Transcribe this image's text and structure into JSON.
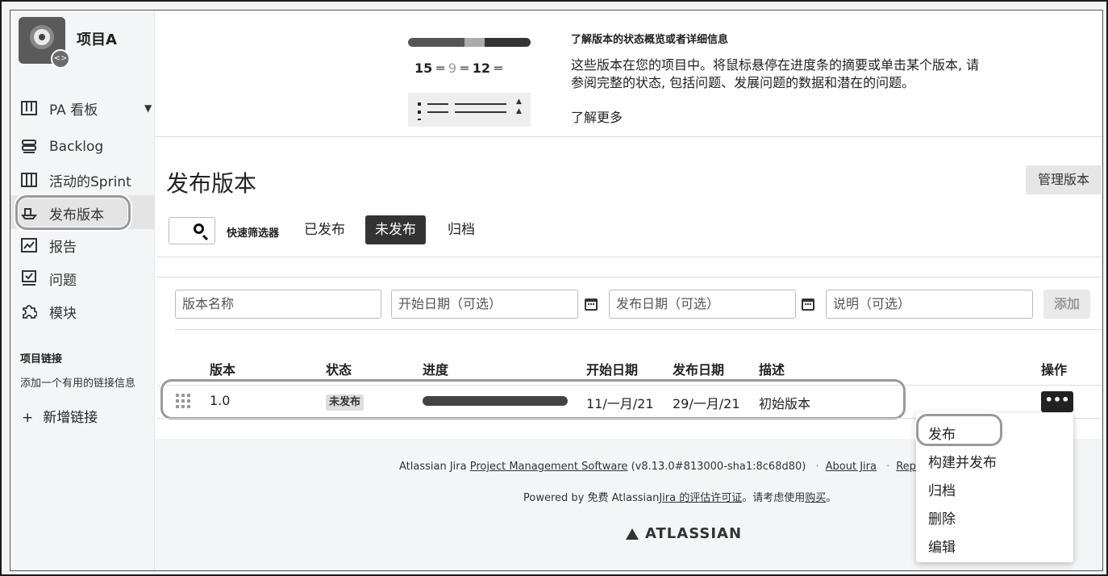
{
  "project": {
    "name": "项目A"
  },
  "sidebar": {
    "items": [
      {
        "label": "PA 看板",
        "icon": "board-icon"
      },
      {
        "label": "Backlog",
        "icon": "backlog-icon"
      },
      {
        "label": "活动的Sprint",
        "icon": "sprint-icon"
      },
      {
        "label": "发布版本",
        "icon": "ship-icon",
        "active": true
      },
      {
        "label": "报告",
        "icon": "chart-icon"
      },
      {
        "label": "问题",
        "icon": "issues-icon"
      },
      {
        "label": "模块",
        "icon": "puzzle-icon"
      }
    ],
    "links_title": "项目链接",
    "links_desc": "添加一个有用的链接信息",
    "add_link": "新增链接"
  },
  "banner": {
    "counts": {
      "a": "15",
      "b": "9",
      "c": "12"
    },
    "title": "了解版本的状态概览或者详细信息",
    "text": "这些版本在您的项目中。将鼠标悬停在进度条的摘要或单击某个版本, 请参阅完整的状态, 包括问题、发展问题的数据和潜在的问题。",
    "more": "了解更多"
  },
  "main": {
    "title": "发布版本",
    "manage_button": "管理版本",
    "quick_filter": "快速筛选器",
    "tabs": [
      {
        "label": "已发布",
        "active": false
      },
      {
        "label": "未发布",
        "active": true
      },
      {
        "label": "归档",
        "active": false
      }
    ],
    "form": {
      "name_placeholder": "版本名称",
      "start_placeholder": "开始日期（可选）",
      "release_placeholder": "发布日期（可选）",
      "desc_placeholder": "说明（可选）",
      "add_button": "添加"
    },
    "table": {
      "headers": [
        "版本",
        "状态",
        "进度",
        "开始日期",
        "发布日期",
        "描述",
        "操作"
      ],
      "rows": [
        {
          "version": "1.0",
          "status": "未发布",
          "progress": 1.0,
          "start": "11/一月/21",
          "release": "29/一月/21",
          "desc": "初始版本",
          "action": "..."
        }
      ]
    }
  },
  "footer": {
    "line1_prefix": "Atlassian Jira",
    "line1_link": "Project Management Software",
    "line1_version": "(v8.13.0#813000-sha1:8c68d80)",
    "about": "About Jira",
    "report": "Repo",
    "line2_prefix": "Powered by 免费 Atlassian",
    "line2_link": "Jira 的评估许可证",
    "line2_mid": "。请考虑使用",
    "line2_buy": "购买",
    "line2_end": "。",
    "logo": "ATLASSIAN"
  },
  "dropdown": [
    "发布",
    "构建并发布",
    "归档",
    "删除",
    "编辑"
  ]
}
